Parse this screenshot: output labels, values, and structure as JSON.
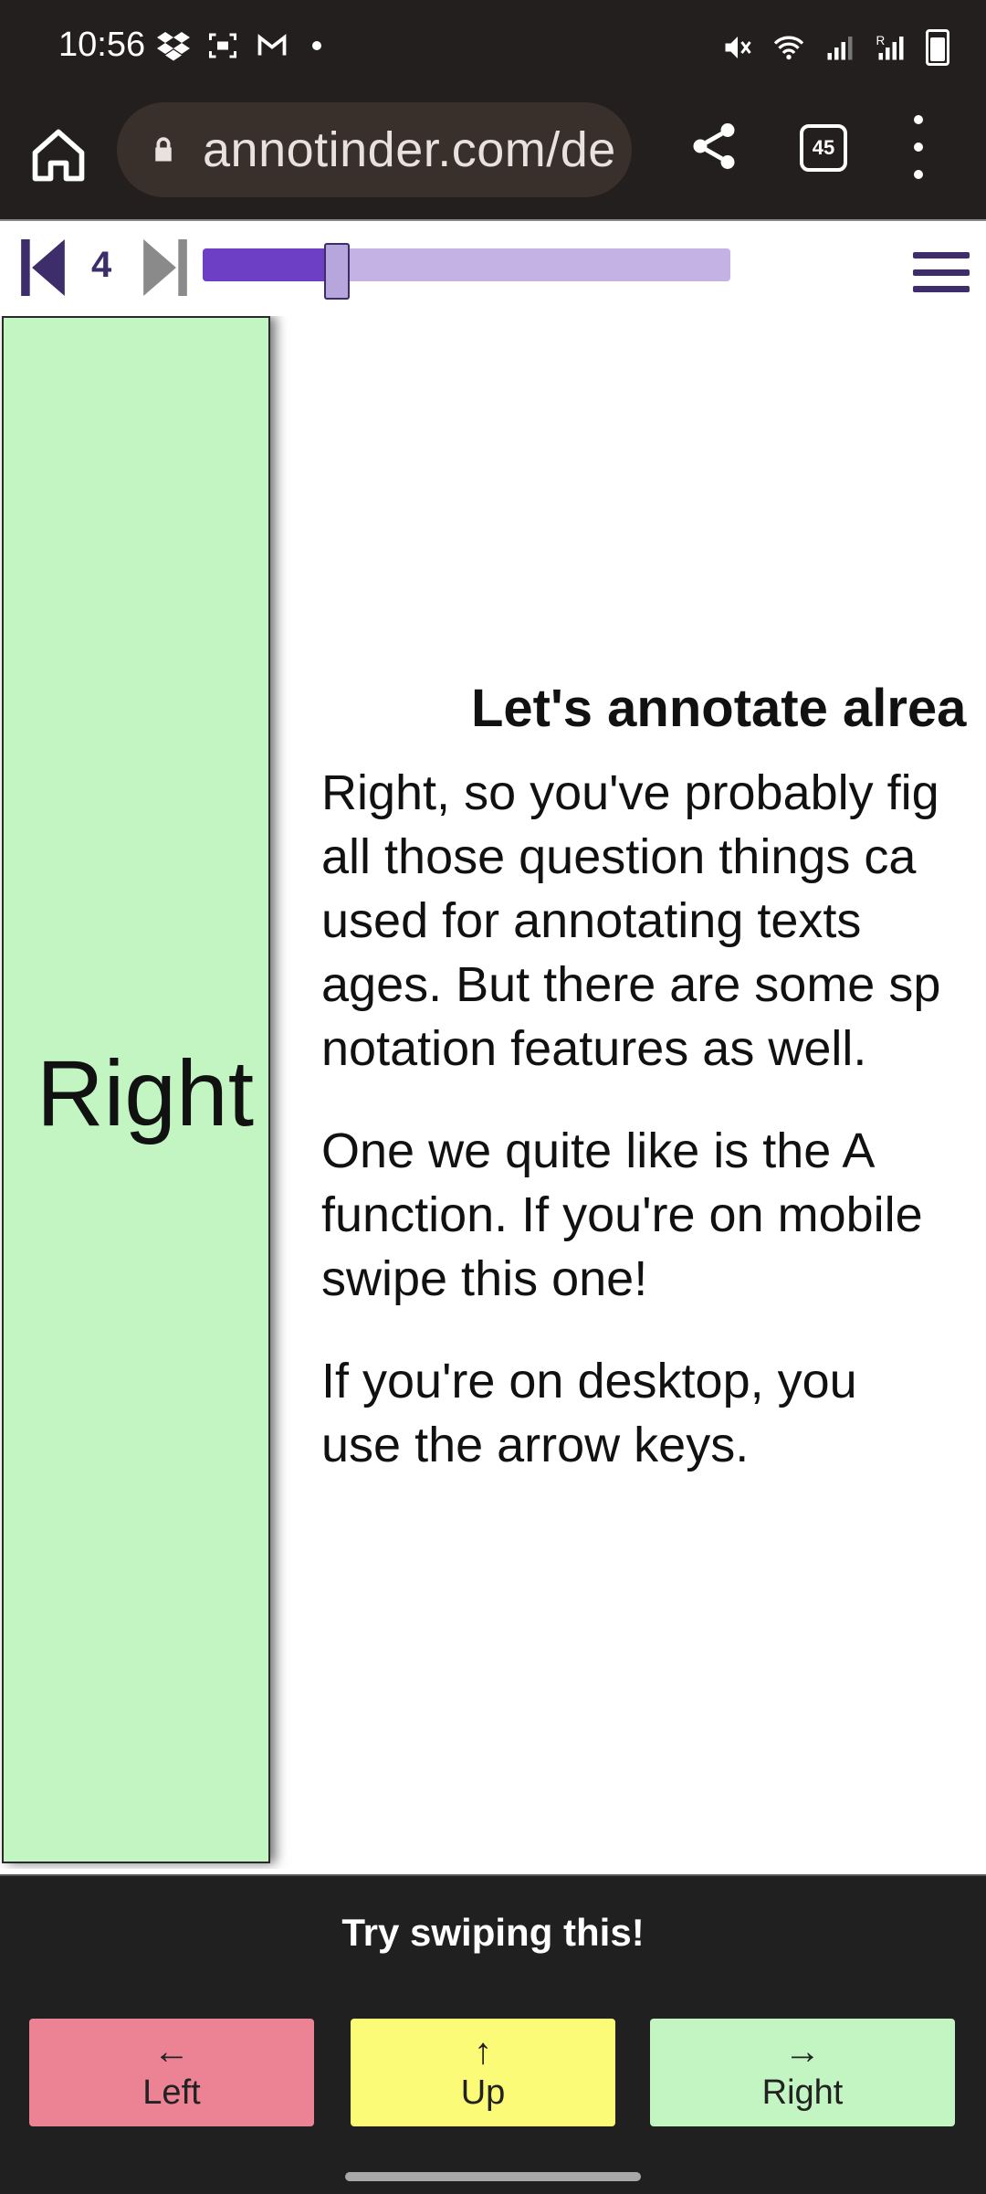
{
  "status_bar": {
    "time": "10:56",
    "icons_left": [
      "dropbox-icon",
      "screen-record-icon",
      "gmail-icon",
      "notification-dot"
    ],
    "icons_right": [
      "mute-icon",
      "wifi-icon",
      "signal-icon",
      "signal-r-icon",
      "battery-icon"
    ]
  },
  "browser": {
    "url": "annotinder.com/de",
    "tab_count": "45"
  },
  "progress": {
    "current_item": "4",
    "fraction": 0.25,
    "colors": {
      "fill": "#6d3fc4",
      "track": "#c3b2e3",
      "icon": "#3d2e6b"
    }
  },
  "swipe_card": {
    "label": "Right",
    "color": "#c3f5c2"
  },
  "content": {
    "heading": "Let's annotate alrea",
    "paragraphs": [
      "Right, so you've probably fig\nall those question things ca\nused for annotating texts\nages. But there are some sp\nnotation features as well.",
      "One we quite like is the A\nfunction. If you're on mobile\nswipe this one!",
      "If you're on desktop, you\nuse the arrow keys."
    ]
  },
  "footer": {
    "hint": "Try swiping this!",
    "buttons": [
      {
        "label": "Left",
        "arrow": "←",
        "color": "#ec8395"
      },
      {
        "label": "Up",
        "arrow": "↑",
        "color": "#fbfb78"
      },
      {
        "label": "Right",
        "arrow": "→",
        "color": "#c3f5c2"
      }
    ]
  }
}
